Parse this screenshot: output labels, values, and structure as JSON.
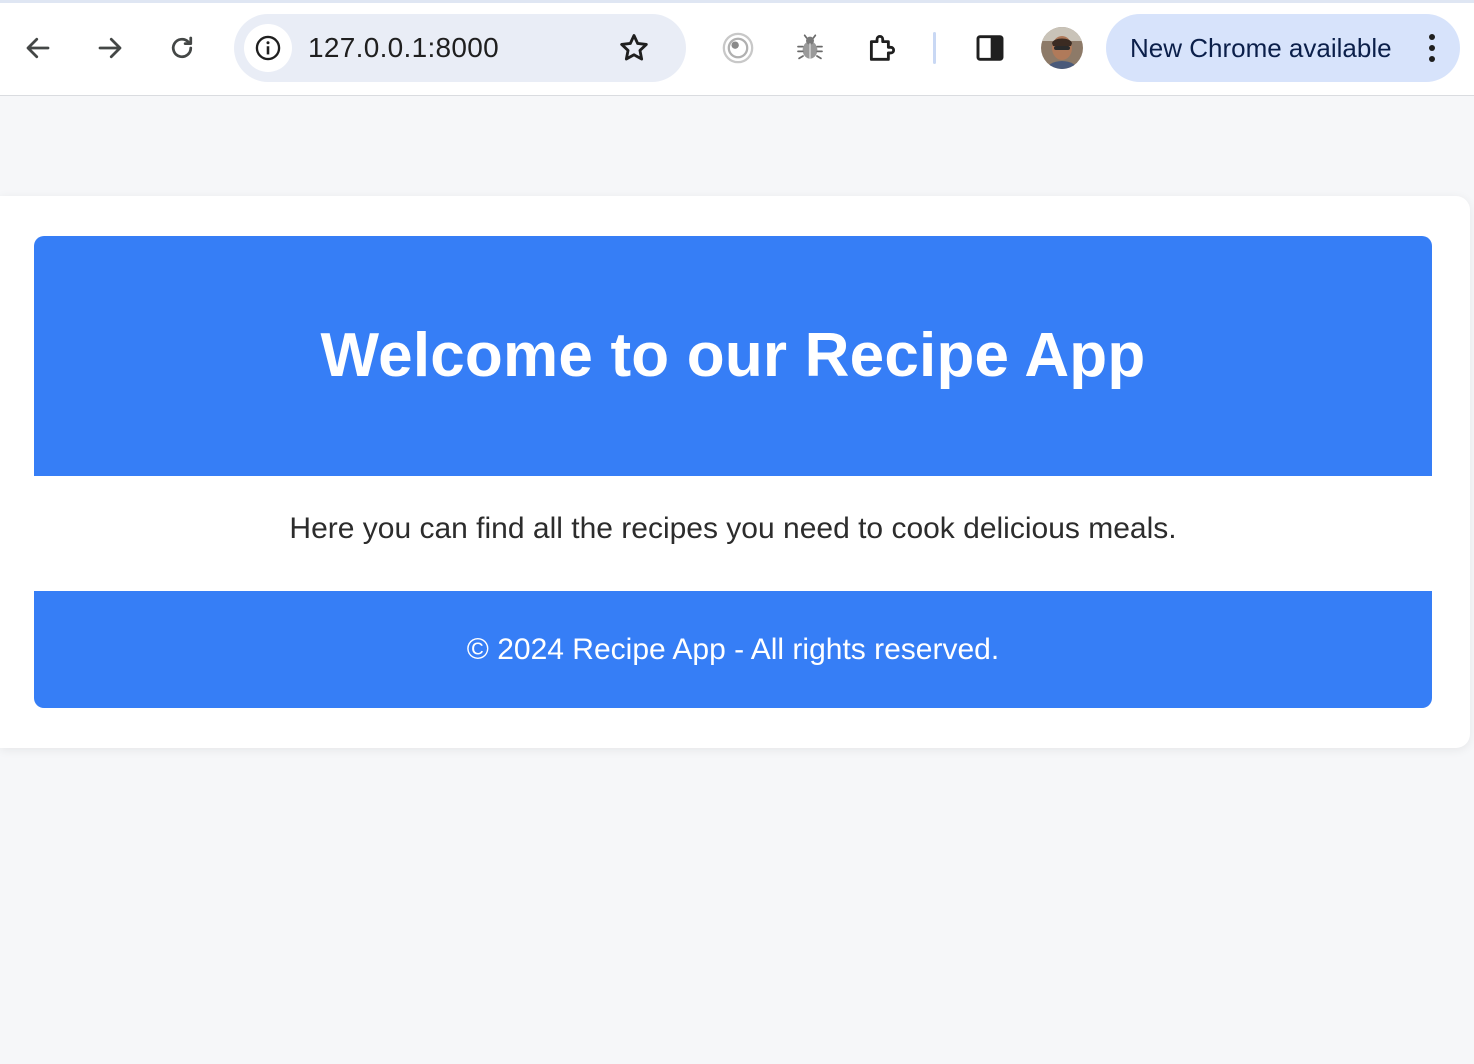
{
  "browser": {
    "url": "127.0.0.1:8000",
    "update_chip_label": "New Chrome available",
    "icons": {
      "back": "arrow-left-icon",
      "forward": "arrow-right-icon",
      "reload": "reload-icon",
      "site_info": "info-icon",
      "bookmark": "star-icon",
      "extension_1": "target-extension-icon",
      "extension_2": "bug-extension-icon",
      "extensions": "puzzle-icon",
      "side_panel": "side-panel-icon",
      "profile": "avatar",
      "menu": "vertical-dots-icon"
    },
    "colors": {
      "omnibox_bg": "#e9edf6",
      "chip_bg": "#d7e3fb"
    }
  },
  "page": {
    "title": "Welcome to our Recipe App",
    "tagline": "Here you can find all the recipes you need to cook delicious meals.",
    "footer_text": "© 2024 Recipe App - All rights reserved.",
    "colors": {
      "accent": "#367ef6",
      "background": "#f6f7f9",
      "card": "#ffffff"
    }
  }
}
